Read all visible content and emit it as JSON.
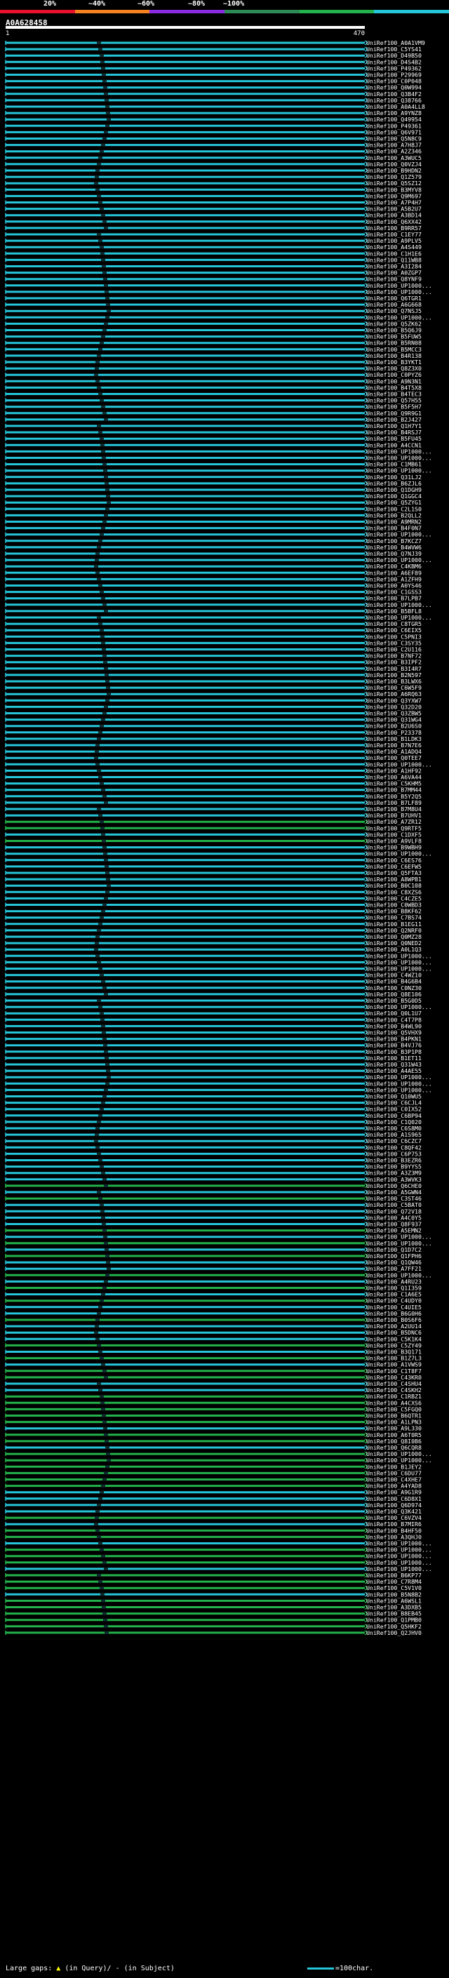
{
  "query": {
    "name": "A0A628458",
    "start": "1",
    "end": "470"
  },
  "identity_legend": {
    "ticks": [
      "20%",
      "~40%",
      "~60%",
      "~80%",
      "~100%"
    ],
    "colors": [
      "#e8112d",
      "#f58220",
      "#8a2be2",
      "#2e8b57",
      "#23b24b",
      "#26c6da"
    ]
  },
  "hits": [
    "UniRef100_A0A1VM9",
    "UniRef100_C5YS41",
    "UniRef100_D49B50",
    "UniRef100_D4S4B2",
    "UniRef100_P49362",
    "UniRef100_P29969",
    "UniRef100_C0P048",
    "UniRef100_Q0W994",
    "UniRef100_Q3B4F2",
    "UniRef100_Q38766",
    "UniRef100_A0A4LL8",
    "UniRef100_A9YNZ8",
    "UniRef100_Q49954",
    "UniRef100_P49361",
    "UniRef100_Q6V971",
    "UniRef100_Q5N8C9",
    "UniRef100_A7H8J7",
    "UniRef100_A2Z346",
    "UniRef100_A3WUC5",
    "UniRef100_Q0VZJ4",
    "UniRef100_B9HDN2",
    "UniRef100_Q1Z579",
    "UniRef100_Q5SZ12",
    "UniRef100_B3MYV8",
    "UniRef100_Q9M697",
    "UniRef100_A7P4H7",
    "UniRef100_A5B2U7",
    "UniRef100_A3BD14",
    "UniRef100_Q6XX42",
    "UniRef100_B9RR57",
    "UniRef100_C1EY77",
    "UniRef100_A9PLV5",
    "UniRef100_A4S449",
    "UniRef100_C1H1E6",
    "UniRef100_Q11WB8",
    "UniRef100_A3I284",
    "UniRef100_A0ZGP7",
    "UniRef100_Q8YNF9",
    "UniRef100_UP1000...",
    "UniRef100_UP1000...",
    "UniRef100_Q6TGR1",
    "UniRef100_A6G668",
    "UniRef100_Q7NSJ5",
    "UniRef100_UP1000...",
    "UniRef100_Q5ZK62",
    "UniRef100_B5Q6J9",
    "UniRef100_B5FUW5",
    "UniRef100_B5RN08",
    "UniRef100_B5MCC3",
    "UniRef100_B4R138",
    "UniRef100_B3YKT1",
    "UniRef100_Q8Z3X0",
    "UniRef100_C0PYZ6",
    "UniRef100_A9N3N1",
    "UniRef100_B4T5X8",
    "UniRef100_B4TEC3",
    "UniRef100_Q57H55",
    "UniRef100_B5F5H7",
    "UniRef100_Q9R9G1",
    "UniRef100_B2J427",
    "UniRef100_Q1H7Y1",
    "UniRef100_B4RSJ7",
    "UniRef100_B5FU45",
    "UniRef100_A4CCN1",
    "UniRef100_UP1000...",
    "UniRef100_UP1000...",
    "UniRef100_C1MB61",
    "UniRef100_UP1000...",
    "UniRef100_Q31LJ2",
    "UniRef100_B6ZJL6",
    "UniRef100_Q1DGH9",
    "UniRef100_Q1GGC4",
    "UniRef100_Q5ZYG1",
    "UniRef100_C2L1S0",
    "UniRef100_B2QLL2",
    "UniRef100_A9MRN2",
    "UniRef100_B4F0N7",
    "UniRef100_UP1000...",
    "UniRef100_B7KCZ7",
    "UniRef100_B4WVW6",
    "UniRef100_Q7NJ39",
    "UniRef100_UP1000...",
    "UniRef100_C4KBM6",
    "UniRef100_A6EF89",
    "UniRef100_A1ZFH9",
    "UniRef100_A0YS46",
    "UniRef100_C1GSS3",
    "UniRef100_B7LPB7",
    "UniRef100_UP1000...",
    "UniRef100_B5BFL8",
    "UniRef100_UP1000...",
    "UniRef100_C8TGR5",
    "UniRef100_C6EIX5",
    "UniRef100_C5PNI3",
    "UniRef100_C3SY35",
    "UniRef100_C2U116",
    "UniRef100_B7NF72",
    "UniRef100_B3IPF2",
    "UniRef100_B3I4R7",
    "UniRef100_B2N597",
    "UniRef100_B3LWX6",
    "UniRef100_C6W5F9",
    "UniRef100_A6RQ63",
    "UniRef100_Q3YXW7",
    "UniRef100_Q32D20",
    "UniRef100_Q3ZBW5",
    "UniRef100_Q31WG4",
    "UniRef100_B2U6S0",
    "UniRef100_P23378",
    "UniRef100_B1LDK3",
    "UniRef100_B7N7E6",
    "UniRef100_A1ADQ4",
    "UniRef100_Q0TEE7",
    "UniRef100_UP1000...",
    "UniRef100_A1HF92",
    "UniRef100_A6VA44",
    "UniRef100_C5KHM5",
    "UniRef100_B7MM44",
    "UniRef100_B5Y2Q5",
    "UniRef100_B7LF89",
    "UniRef100_B7M8U4",
    "UniRef100_B7UHV1",
    "UniRef100_A7ZR12",
    "UniRef100_Q9RTF5",
    "UniRef100_C1DXF5",
    "UniRef100_A9VLF8",
    "UniRef100_B9WBH9",
    "UniRef100_UP1000...",
    "UniRef100_C6ES76",
    "UniRef100_C6EFW5",
    "UniRef100_Q5FTA3",
    "UniRef100_A8WPB1",
    "UniRef100_B0C108",
    "UniRef100_C8XZS6",
    "UniRef100_C4CZE5",
    "UniRef100_C0WBD3",
    "UniRef100_B8KF62",
    "UniRef100_C7BS74",
    "UniRef100_B1EG11",
    "UniRef100_Q2NRF0",
    "UniRef100_Q0MZ28",
    "UniRef100_Q0NED2",
    "UniRef100_A0L1Q3",
    "UniRef100_UP1000...",
    "UniRef100_UP1000...",
    "UniRef100_UP1000...",
    "UniRef100_C4WZ10",
    "UniRef100_B4G6B4",
    "UniRef100_C0NZ30",
    "UniRef100_Q8E106",
    "UniRef100_B5G0D5",
    "UniRef100_UP1000...",
    "UniRef100_Q0L1U7",
    "UniRef100_C4T7P8",
    "UniRef100_B4WL90",
    "UniRef100_Q5VHX9",
    "UniRef100_B4PKN1",
    "UniRef100_B4VJ76",
    "UniRef100_B3P1P8",
    "UniRef100_B1ET11",
    "UniRef100_Q31W43",
    "UniRef100_A4AE55",
    "UniRef100_UP1000...",
    "UniRef100_UP1000...",
    "UniRef100_UP1000...",
    "UniRef100_Q10WU5",
    "UniRef100_C6CJL4",
    "UniRef100_C0IX52",
    "UniRef100_C6BP94",
    "UniRef100_C1Q020",
    "UniRef100_C6S8M0",
    "UniRef100_A1S965",
    "UniRef100_C6CZC7",
    "UniRef100_C8QF42",
    "UniRef100_C6P753",
    "UniRef100_B3EZR6",
    "UniRef100_B9YYS5",
    "UniRef100_A3Z3M9",
    "UniRef100_A3WVK3",
    "UniRef100_Q6CHE0",
    "UniRef100_A5GWN4",
    "UniRef100_C3ST46",
    "UniRef100_C5BAT0",
    "UniRef100_Q72V18",
    "UniRef100_A4C0Y5",
    "UniRef100_Q8F937",
    "UniRef100_A5EMN2",
    "UniRef100_UP1000...",
    "UniRef100_UP1000...",
    "UniRef100_Q1D7C2",
    "UniRef100_Q1FPH6",
    "UniRef100_Q1QW46",
    "UniRef100_A7FF21",
    "UniRef100_UP1000...",
    "UniRef100_A4RU23",
    "UniRef100_Q1I359",
    "UniRef100_C1A6E5",
    "UniRef100_C4UDY0",
    "UniRef100_C4UIE5",
    "UniRef100_B6G0H6",
    "UniRef100_B0S6F6",
    "UniRef100_A2UU14",
    "UniRef100_B5DNC6",
    "UniRef100_C5K1K4",
    "UniRef100_C5ZY49",
    "UniRef100_B3Q171",
    "UniRef100_B1Z7L3",
    "UniRef100_A1VWS9",
    "UniRef100_C1T8F7",
    "UniRef100_C43KR0",
    "UniRef100_C4SHU4",
    "UniRef100_C4SKH2",
    "UniRef100_C1RBZ1",
    "UniRef100_A4CXS6",
    "UniRef100_C5FGQ0",
    "UniRef100_B6QTR1",
    "UniRef100_A1LPN3",
    "UniRef100_A9L330",
    "UniRef100_A6T0R5",
    "UniRef100_Q8I0B6",
    "UniRef100_Q6CQR8",
    "UniRef100_UP1000...",
    "UniRef100_UP1000...",
    "UniRef100_B1JEY2",
    "UniRef100_C6DU77",
    "UniRef100_C4XHE7",
    "UniRef100_A4YAD8",
    "UniRef100_A9G1R9",
    "UniRef100_C6D8X1",
    "UniRef100_Q6D974",
    "UniRef100_Q3K421",
    "UniRef100_C6VZV4",
    "UniRef100_B7MIR6",
    "UniRef100_B4HF50",
    "UniRef100_A3QHJ0",
    "UniRef100_UP1000...",
    "UniRef100_UP1000...",
    "UniRef100_UP1000...",
    "UniRef100_UP1000...",
    "UniRef100_UP1000...",
    "UniRef100_B6KP77",
    "UniRef100_C7R8M4",
    "UniRef100_C5V1V0",
    "UniRef100_B5N8B2",
    "UniRef100_A6WSL1",
    "UniRef100_A3DXB5",
    "UniRef100_B8EB45",
    "UniRef100_Q1PMB0",
    "UniRef100_Q5HKF2",
    "UniRef100_Q2JHV0"
  ],
  "hit_identity": [
    "#26c6da",
    "#26c6da",
    "#26c6da",
    "#26c6da",
    "#26c6da",
    "#26c6da",
    "#26c6da",
    "#26c6da",
    "#26c6da",
    "#26c6da",
    "#26c6da",
    "#26c6da",
    "#26c6da",
    "#26c6da",
    "#26c6da",
    "#26c6da",
    "#26c6da",
    "#26c6da",
    "#26c6da",
    "#26c6da",
    "#26c6da",
    "#26c6da",
    "#26c6da",
    "#26c6da",
    "#26c6da",
    "#26c6da",
    "#26c6da",
    "#26c6da",
    "#26c6da",
    "#26c6da",
    "#26c6da",
    "#26c6da",
    "#26c6da",
    "#26c6da",
    "#26c6da",
    "#26c6da",
    "#26c6da",
    "#26c6da",
    "#26c6da",
    "#26c6da",
    "#26c6da",
    "#26c6da",
    "#26c6da",
    "#26c6da",
    "#26c6da",
    "#26c6da",
    "#26c6da",
    "#26c6da",
    "#26c6da",
    "#26c6da",
    "#26c6da",
    "#26c6da",
    "#26c6da",
    "#26c6da",
    "#26c6da",
    "#26c6da",
    "#26c6da",
    "#26c6da",
    "#26c6da",
    "#26c6da",
    "#26c6da",
    "#26c6da",
    "#26c6da",
    "#26c6da",
    "#26c6da",
    "#26c6da",
    "#26c6da",
    "#26c6da",
    "#26c6da",
    "#26c6da",
    "#26c6da",
    "#26c6da",
    "#26c6da",
    "#26c6da",
    "#26c6da",
    "#26c6da",
    "#26c6da",
    "#26c6da",
    "#26c6da",
    "#26c6da",
    "#26c6da",
    "#26c6da",
    "#26c6da",
    "#26c6da",
    "#26c6da",
    "#26c6da",
    "#26c6da",
    "#26c6da",
    "#26c6da",
    "#26c6da",
    "#26c6da",
    "#26c6da",
    "#26c6da",
    "#26c6da",
    "#26c6da",
    "#26c6da",
    "#26c6da",
    "#26c6da",
    "#26c6da",
    "#26c6da",
    "#26c6da",
    "#26c6da",
    "#26c6da",
    "#26c6da",
    "#26c6da",
    "#26c6da",
    "#26c6da",
    "#26c6da",
    "#26c6da",
    "#26c6da",
    "#26c6da",
    "#26c6da",
    "#26c6da",
    "#26c6da",
    "#26c6da",
    "#26c6da",
    "#26c6da",
    "#26c6da",
    "#26c6da",
    "#26c6da",
    "#26c6da",
    "#26c6da",
    "#23b24b",
    "#23b24b",
    "#26c6da",
    "#23b24b",
    "#26c6da",
    "#26c6da",
    "#26c6da",
    "#26c6da",
    "#26c6da",
    "#26c6da",
    "#26c6da",
    "#26c6da",
    "#26c6da",
    "#26c6da",
    "#26c6da",
    "#26c6da",
    "#26c6da",
    "#26c6da",
    "#26c6da",
    "#26c6da",
    "#26c6da",
    "#26c6da",
    "#26c6da",
    "#26c6da",
    "#26c6da",
    "#26c6da",
    "#26c6da",
    "#26c6da",
    "#26c6da",
    "#26c6da",
    "#26c6da",
    "#26c6da",
    "#26c6da",
    "#26c6da",
    "#26c6da",
    "#26c6da",
    "#26c6da",
    "#26c6da",
    "#26c6da",
    "#26c6da",
    "#26c6da",
    "#26c6da",
    "#26c6da",
    "#26c6da",
    "#26c6da",
    "#26c6da",
    "#26c6da",
    "#26c6da",
    "#26c6da",
    "#26c6da",
    "#26c6da",
    "#26c6da",
    "#26c6da",
    "#26c6da",
    "#26c6da",
    "#26c6da",
    "#26c6da",
    "#23b24b",
    "#26c6da",
    "#23b24b",
    "#26c6da",
    "#26c6da",
    "#26c6da",
    "#26c6da",
    "#23b24b",
    "#26c6da",
    "#23b24b",
    "#26c6da",
    "#23b24b",
    "#26c6da",
    "#26c6da",
    "#23b24b",
    "#26c6da",
    "#23b24b",
    "#26c6da",
    "#23b24b",
    "#26c6da",
    "#26c6da",
    "#23b24b",
    "#26c6da",
    "#26c6da",
    "#26c6da",
    "#23b24b",
    "#26c6da",
    "#23b24b",
    "#26c6da",
    "#23b24b",
    "#23b24b",
    "#26c6da",
    "#26c6da",
    "#23b24b",
    "#23b24b",
    "#23b24b",
    "#23b24b",
    "#23b24b",
    "#26c6da",
    "#23b24b",
    "#23b24b",
    "#26c6da",
    "#23b24b",
    "#23b24b",
    "#23b24b",
    "#23b24b",
    "#23b24b",
    "#23b24b",
    "#26c6da",
    "#26c6da",
    "#26c6da",
    "#26c6da",
    "#23b24b",
    "#26c6da",
    "#23b24b",
    "#23b24b",
    "#26c6da",
    "#23b24b",
    "#23b24b",
    "#23b24b",
    "#26c6da",
    "#23b24b",
    "#23b24b",
    "#23b24b",
    "#26c6da",
    "#23b24b",
    "#23b24b",
    "#23b24b",
    "#23b24b",
    "#23b24b",
    "#23b24b",
    "#23b24b",
    "#23b24b",
    "#23b24b",
    "#23b24b",
    "#23b24b",
    "#23b24b",
    "#23b24b",
    "#23b24b",
    "#23b24b",
    "#23b24b",
    "#23b24b",
    "#23b24b",
    "#23b24b",
    "#23b24b"
  ],
  "footer": {
    "label": "Large gaps:",
    "query_gap": "(in Query)/",
    "subject_gap": "- (in Subject)",
    "scale": "=100char."
  }
}
